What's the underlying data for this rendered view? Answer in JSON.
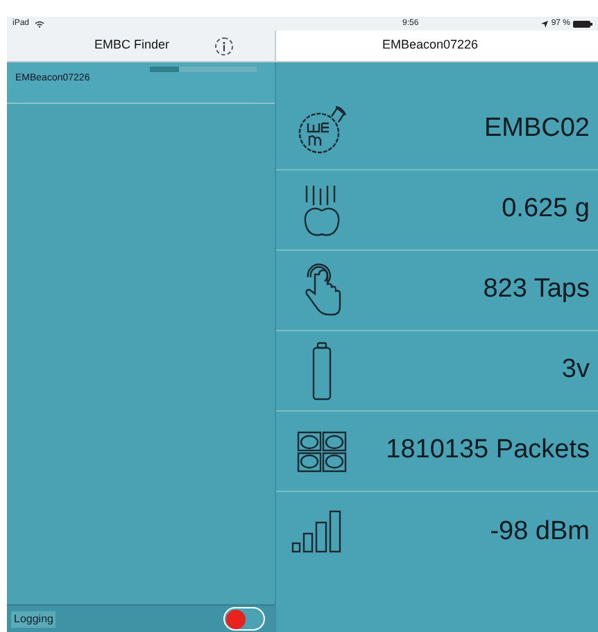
{
  "status_bar": {
    "device": "iPad",
    "time": "9:56",
    "battery": "97 %"
  },
  "left_nav": {
    "title": "EMBC Finder"
  },
  "right_nav": {
    "title": "EMBeacon07226"
  },
  "devices": [
    {
      "name": "EMBeacon07226",
      "level": 0.28,
      "selected": true
    }
  ],
  "readings": [
    {
      "kind": "logo",
      "value": "EMBC02"
    },
    {
      "kind": "acceleration",
      "value": "0.625 g"
    },
    {
      "kind": "taps",
      "value": "823 Taps"
    },
    {
      "kind": "battery",
      "value": "3v"
    },
    {
      "kind": "packets",
      "value": "1810135 Packets"
    },
    {
      "kind": "signal",
      "value": "-98 dBm"
    }
  ],
  "logging": {
    "label": "Logging",
    "on": false
  }
}
